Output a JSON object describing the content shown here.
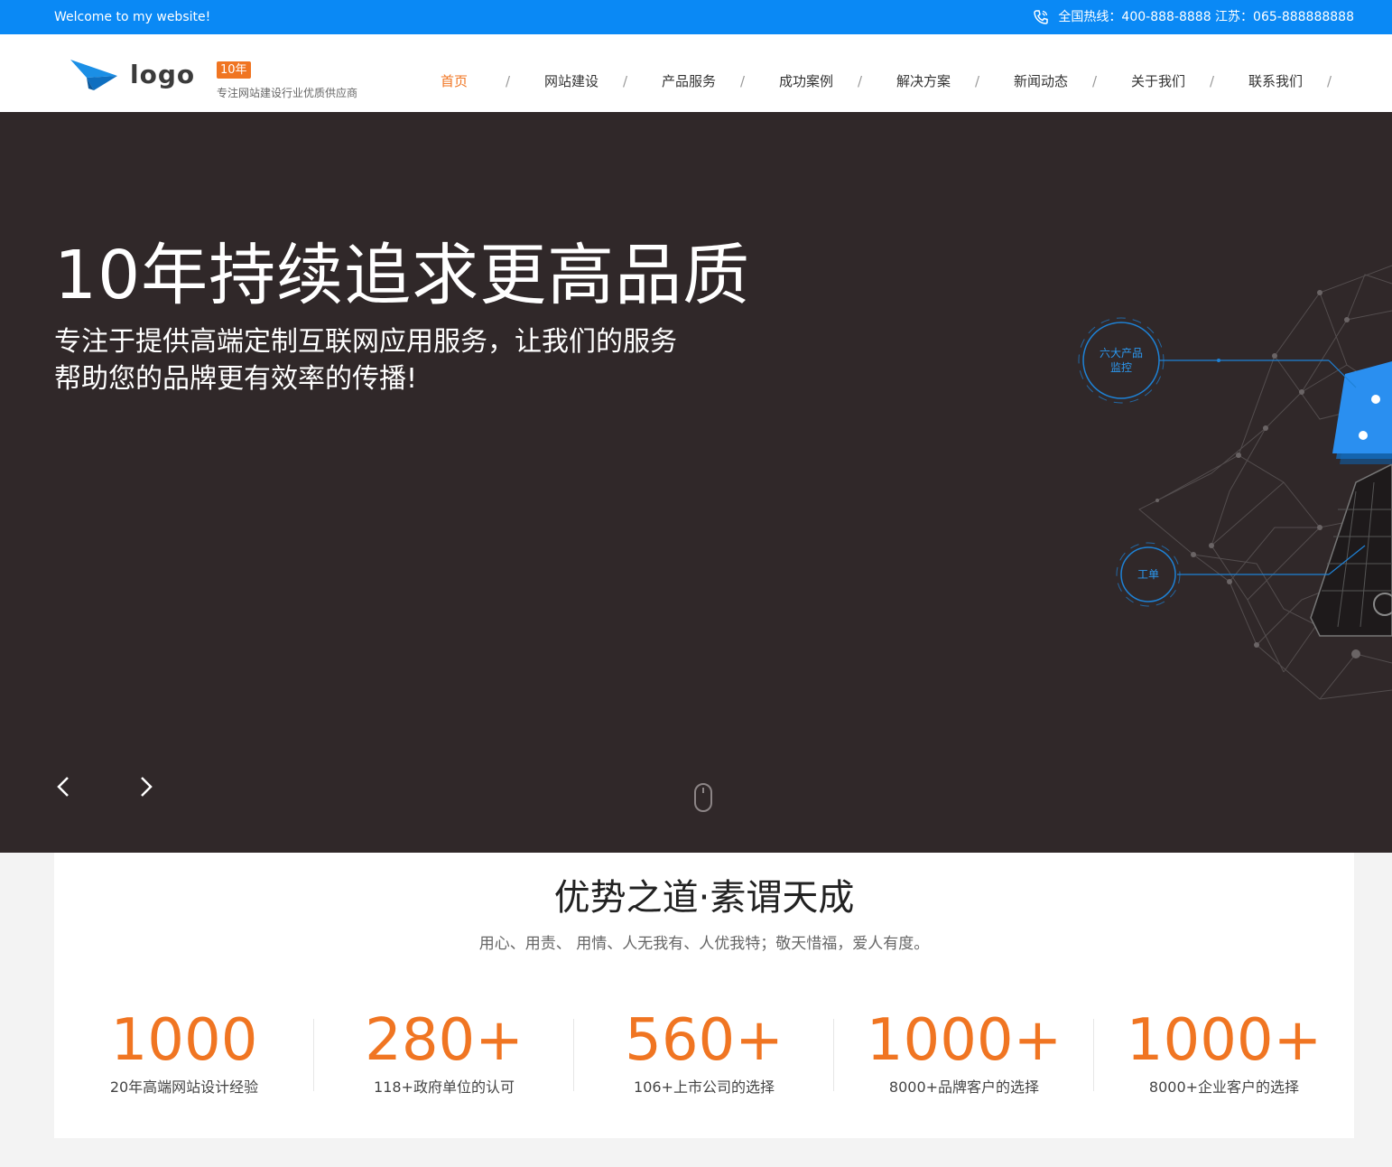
{
  "topbar": {
    "welcome": "Welcome to my website!",
    "hotline": "全国热线：400-888-8888 江苏：065-888888888"
  },
  "header": {
    "logo_text": "logo",
    "badge": "10年",
    "tagline": "专注网站建设行业优质供应商"
  },
  "nav": {
    "items": [
      {
        "label": "首页",
        "active": true
      },
      {
        "label": "网站建设"
      },
      {
        "label": "产品服务"
      },
      {
        "label": "成功案例"
      },
      {
        "label": "解决方案"
      },
      {
        "label": "新闻动态"
      },
      {
        "label": "关于我们"
      },
      {
        "label": "联系我们"
      }
    ],
    "separator": "/"
  },
  "hero": {
    "title": "10年持续追求更高品质",
    "subtitle_line1": "专注于提供高端定制互联网应用服务，让我们的服务",
    "subtitle_line2": "帮助您的品牌更有效率的传播!",
    "graphic_label_1": "六大产品监控",
    "graphic_label_1a": "六大产品",
    "graphic_label_1b": "监控",
    "graphic_label_2": "工单"
  },
  "advantages": {
    "title": "优势之道·素谓天成",
    "desc": "用心、用责、 用情、人无我有、人优我特；敬天惜福，爱人有度。",
    "stats": [
      {
        "num": "1000",
        "label": "20年高端网站设计经验"
      },
      {
        "num": "280+",
        "label": "118+政府单位的认可"
      },
      {
        "num": "560+",
        "label": "106+上市公司的选择"
      },
      {
        "num": "1000+",
        "label": "8000+品牌客户的选择"
      },
      {
        "num": "1000+",
        "label": "8000+企业客户的选择"
      }
    ]
  },
  "colors": {
    "topbar": "#0a89f5",
    "accent": "#f07522",
    "hero_bg": "#302829"
  },
  "icons": {
    "phone": "phone-icon",
    "plane": "paper-plane-icon",
    "prev": "chevron-left-icon",
    "next": "chevron-right-icon",
    "mouse": "mouse-scroll-icon"
  }
}
